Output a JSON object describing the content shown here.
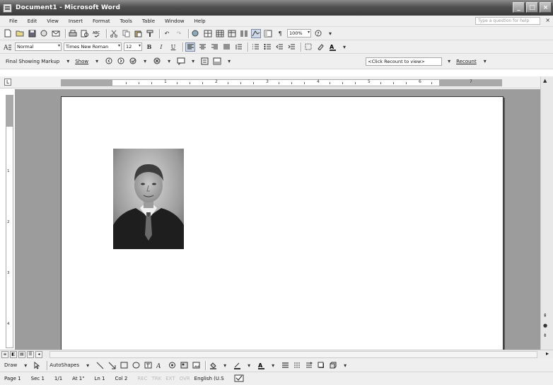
{
  "window": {
    "title": "Document1 - Microsoft Word",
    "buttons": [
      "_",
      "□",
      "×"
    ]
  },
  "menu": {
    "items": [
      "File",
      "Edit",
      "View",
      "Insert",
      "Format",
      "Tools",
      "Table",
      "Window",
      "Help"
    ],
    "ask_placeholder": "Type a question for help"
  },
  "standard_toolbar": {
    "zoom": "100%"
  },
  "formatting_toolbar": {
    "style": "Normal",
    "font": "Times New Roman",
    "size": "12"
  },
  "reviewing_toolbar": {
    "display": "Final Showing Markup",
    "show": "Show",
    "recount_field": "<Click Recount to view>",
    "recount": "Recount"
  },
  "ruler": {
    "numbers": [
      "1",
      "2",
      "3",
      "4",
      "5",
      "6",
      "7"
    ],
    "vertical_numbers": [
      "1",
      "2",
      "3",
      "4"
    ]
  },
  "drawing_toolbar": {
    "draw": "Draw",
    "autoshapes": "AutoShapes"
  },
  "status_bar": {
    "page": "Page 1",
    "section": "Sec 1",
    "pages": "1/1",
    "at": "At 1\"",
    "line": "Ln 1",
    "col": "Col 2",
    "rec": "REC",
    "trk": "TRK",
    "ext": "EXT",
    "ovr": "OVR",
    "language": "English (U.S"
  },
  "colors": {
    "titlebar": "#505050",
    "workspace": "#9c9c9c",
    "page": "#ffffff",
    "chrome": "#efefef"
  }
}
